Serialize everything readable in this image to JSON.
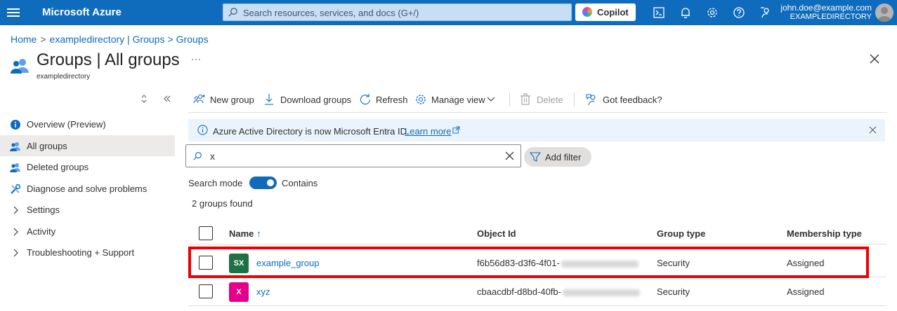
{
  "topbar": {
    "brand": "Microsoft Azure",
    "search_placeholder": "Search resources, services, and docs (G+/)",
    "copilot_label": "Copilot",
    "user_name": "john.doe@example.com",
    "user_directory": "EXAMPLEDIRECTORY"
  },
  "breadcrumb": {
    "home": "Home",
    "directory": "exampledirectory | Groups",
    "groups": "Groups",
    "sep1": ">",
    "sep2": ">"
  },
  "header": {
    "title": "Groups | All groups",
    "subtitle": "exampledirectory",
    "more": "···"
  },
  "nav": {
    "items": [
      {
        "label": "Overview (Preview)",
        "icon": "info-icon"
      },
      {
        "label": "All groups",
        "icon": "groups-icon"
      },
      {
        "label": "Deleted groups",
        "icon": "groups-icon"
      },
      {
        "label": "Diagnose and solve problems",
        "icon": "wrench-icon"
      },
      {
        "label": "Settings",
        "icon": "chevron-right-icon"
      },
      {
        "label": "Activity",
        "icon": "chevron-right-icon"
      },
      {
        "label": "Troubleshooting + Support",
        "icon": "chevron-right-icon"
      }
    ],
    "active_index": 1
  },
  "toolbar": {
    "new_group": "New group",
    "download_groups": "Download groups",
    "refresh": "Refresh",
    "manage_view": "Manage view",
    "delete": "Delete",
    "got_feedback": "Got feedback?"
  },
  "banner": {
    "text": "Azure Active Directory is now Microsoft Entra ID.",
    "link": "Learn more"
  },
  "filter": {
    "value": "x",
    "add_filter": "Add filter",
    "search_mode_label": "Search mode",
    "search_mode_value": "Contains",
    "results_count": "2 groups found"
  },
  "table": {
    "columns": [
      "Name",
      "Object Id",
      "Group type",
      "Membership type"
    ],
    "sort_indicator": "↑",
    "rows": [
      {
        "initials": "SX",
        "avatar_color": "#1e7145",
        "name": "example_group",
        "object_id": "f6b56d83-d3f6-4f01-",
        "group_type": "Security",
        "membership_type": "Assigned"
      },
      {
        "initials": "X",
        "avatar_color": "#e3008c",
        "name": "xyz",
        "object_id": "cbaacdbf-d8bd-40fb-",
        "group_type": "Security",
        "membership_type": "Assigned"
      }
    ]
  },
  "colors": {
    "accent": "#0f6cbd",
    "highlight": "#ee0000"
  }
}
